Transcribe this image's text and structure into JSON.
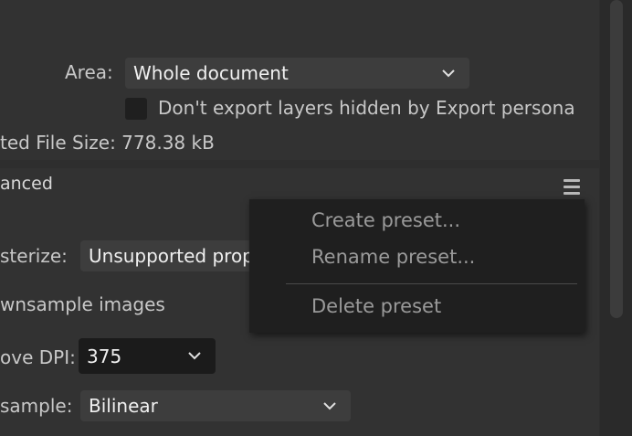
{
  "export": {
    "area_label": "Area:",
    "area_value": "Whole document",
    "hidden_layers_label": "Don't export layers hidden by Export persona",
    "file_size_text": "ted File Size: 778.38 kB"
  },
  "advanced": {
    "section_title": "anced",
    "rasterize_label": "sterize:",
    "rasterize_value": "Unsupported prop",
    "downsample_label": "wnsample images",
    "above_dpi_label": "ove DPI:",
    "above_dpi_value": "375",
    "resample_label": "sample:",
    "resample_value": "Bilinear"
  },
  "menu": {
    "items": [
      {
        "label": "Create preset..."
      },
      {
        "label": "Rename preset..."
      },
      {
        "label": "Delete preset"
      }
    ]
  },
  "colors": {
    "panel": "#323232",
    "background": "#2e2e2e",
    "menu": "#1f1f1f",
    "dropdown": "#3d3d3d",
    "dropdown_dark": "#1b1b1b"
  }
}
